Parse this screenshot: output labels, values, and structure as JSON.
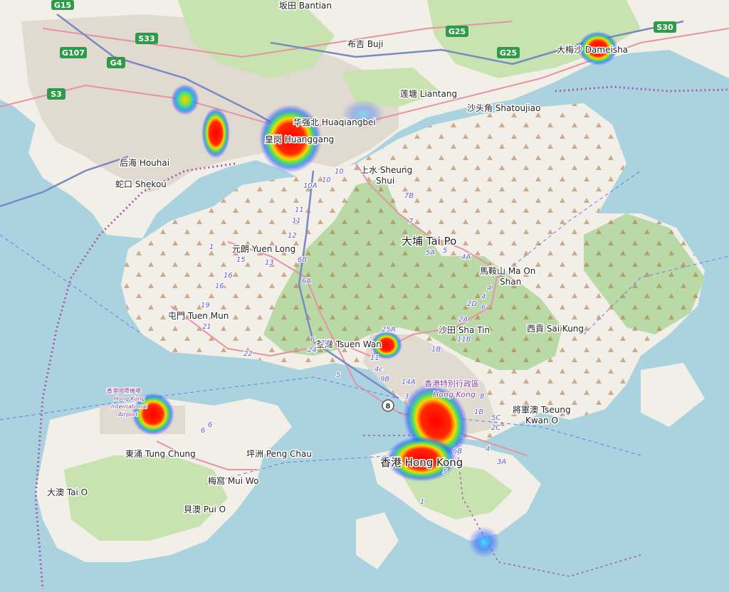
{
  "map": {
    "colors": {
      "water": "#aad3df",
      "land": "#f2efe9",
      "urban": "#e0dad0",
      "forest": "#b9d9a6",
      "park": "#c8e3b0",
      "road": "#e892a2",
      "motorway": "#7a89c4",
      "highway_shield": "#2f9a4a",
      "border": "#a35aa7"
    },
    "places": [
      {
        "id": "bantian",
        "text": "坂田 Bantian"
      },
      {
        "id": "buji",
        "text": "布吉 Buji"
      },
      {
        "id": "liantang",
        "text": "莲塘 Liantang"
      },
      {
        "id": "shatoujiao",
        "text": "沙头角 Shatoujiao"
      },
      {
        "id": "dameisha",
        "text": "大梅沙 Dameisha"
      },
      {
        "id": "huaqiangbei",
        "text": "华强北 Huaqiangbei"
      },
      {
        "id": "huanggang",
        "text": "皇岗 Huanggang"
      },
      {
        "id": "houhai",
        "text": "后海 Houhai"
      },
      {
        "id": "shekou",
        "text": "蛇口 Shekou"
      },
      {
        "id": "sheung-shui",
        "text": "上水 Sheung"
      },
      {
        "id": "sheung-shui-2",
        "text": "Shui"
      },
      {
        "id": "tai-po",
        "text": "大埔 Tai Po"
      },
      {
        "id": "yuen-long",
        "text": "元朗 Yuen Long"
      },
      {
        "id": "ma-on-shan",
        "text": "馬鞍山 Ma On"
      },
      {
        "id": "ma-on-shan-2",
        "text": "Shan"
      },
      {
        "id": "tuen-mun",
        "text": "屯門 Tuen Mun"
      },
      {
        "id": "sha-tin",
        "text": "沙田 Sha Tin"
      },
      {
        "id": "sai-kung",
        "text": "西貢 Sai Kung"
      },
      {
        "id": "tsuen-wan",
        "text": "荃灣 Tsuen Wan"
      },
      {
        "id": "tseung-kwan-o",
        "text": "將軍澳 Tseung"
      },
      {
        "id": "tseung-kwan-o-2",
        "text": "Kwan O"
      },
      {
        "id": "tung-chung",
        "text": "東涌 Tung Chung"
      },
      {
        "id": "peng-chau",
        "text": "坪洲 Peng Chau"
      },
      {
        "id": "mui-wo",
        "text": "梅窩 Mui Wo"
      },
      {
        "id": "tai-o",
        "text": "大澳 Tai O"
      },
      {
        "id": "pui-o",
        "text": "貝澳 Pui O"
      },
      {
        "id": "hong-kong",
        "text": "香港 Hong Kong"
      }
    ],
    "purple_labels": [
      {
        "id": "hksar",
        "text": "香港特別行政區"
      },
      {
        "id": "hksar-en",
        "text": "Hong Kong"
      },
      {
        "id": "airport-zh",
        "text": "香港國際機場"
      },
      {
        "id": "airport-en1",
        "text": "Hong Kong"
      },
      {
        "id": "airport-en2",
        "text": "International"
      },
      {
        "id": "airport-en3",
        "text": "Airport"
      }
    ],
    "shields": [
      {
        "id": "g15",
        "text": "G15"
      },
      {
        "id": "s33",
        "text": "S33"
      },
      {
        "id": "g107",
        "text": "G107"
      },
      {
        "id": "g4",
        "text": "G4"
      },
      {
        "id": "s3",
        "text": "S3"
      },
      {
        "id": "g25a",
        "text": "G25"
      },
      {
        "id": "g25b",
        "text": "G25"
      },
      {
        "id": "s30",
        "text": "S30"
      }
    ],
    "route_numbers": [
      "10",
      "10A",
      "10",
      "11",
      "11",
      "12",
      "1",
      "15",
      "13",
      "6B",
      "6A",
      "16",
      "16",
      "19",
      "21",
      "22",
      "6",
      "24",
      "24",
      "25A",
      "7B",
      "7",
      "5A",
      "5",
      "4A",
      "4",
      "4",
      "2D",
      "2A",
      "6",
      "1B",
      "11B",
      "11",
      "4c",
      "9B",
      "14A",
      "3",
      "5",
      "8",
      "1B",
      "5C",
      "2C",
      "6B",
      "4",
      "3A",
      "5",
      "1",
      "6",
      "6"
    ],
    "heat_spots": [
      {
        "id": "heat-dameisha",
        "intensity": 0.85
      },
      {
        "id": "heat-nanshan",
        "intensity": 0.5
      },
      {
        "id": "heat-futian-west",
        "intensity": 0.9
      },
      {
        "id": "heat-huanggang",
        "intensity": 1.0
      },
      {
        "id": "heat-tsuen-wan",
        "intensity": 0.7
      },
      {
        "id": "heat-airport",
        "intensity": 0.9
      },
      {
        "id": "heat-kowloon",
        "intensity": 1.0
      },
      {
        "id": "heat-central",
        "intensity": 1.0
      },
      {
        "id": "heat-stanley",
        "intensity": 0.35
      }
    ]
  }
}
